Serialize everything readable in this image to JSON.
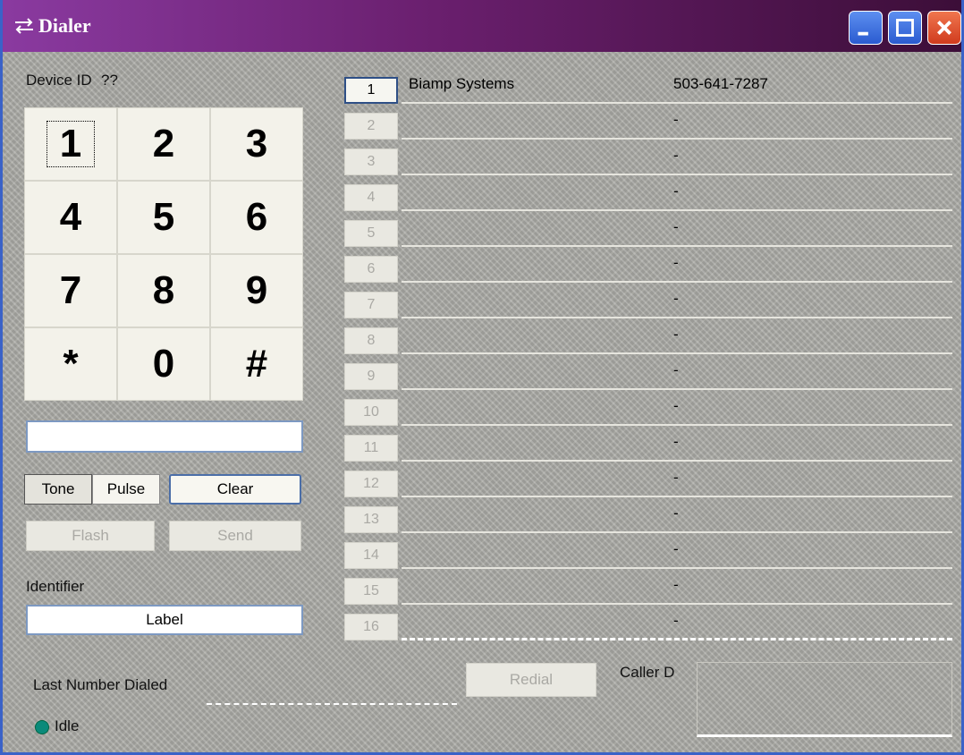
{
  "window": {
    "title": "Dialer",
    "minimize_label": "Minimize",
    "maximize_label": "Maximize",
    "close_label": "Close"
  },
  "device": {
    "label": "Device ID",
    "value": "??"
  },
  "keypad": {
    "keys": [
      "1",
      "2",
      "3",
      "4",
      "5",
      "6",
      "7",
      "8",
      "9",
      "*",
      "0",
      "#"
    ],
    "focused_key": "1"
  },
  "dial_display": {
    "value": ""
  },
  "controls": {
    "tone": "Tone",
    "pulse": "Pulse",
    "clear": "Clear",
    "flash": "Flash",
    "send": "Send"
  },
  "identifier": {
    "heading": "Identifier",
    "value": "Label"
  },
  "speed_dial": [
    {
      "index": "1",
      "name": "Biamp Systems",
      "number": "503-641-7287"
    },
    {
      "index": "2",
      "name": "",
      "number": ""
    },
    {
      "index": "3",
      "name": "",
      "number": ""
    },
    {
      "index": "4",
      "name": "",
      "number": ""
    },
    {
      "index": "5",
      "name": "",
      "number": ""
    },
    {
      "index": "6",
      "name": "",
      "number": ""
    },
    {
      "index": "7",
      "name": "",
      "number": ""
    },
    {
      "index": "8",
      "name": "",
      "number": ""
    },
    {
      "index": "9",
      "name": "",
      "number": ""
    },
    {
      "index": "10",
      "name": "",
      "number": ""
    },
    {
      "index": "11",
      "name": "",
      "number": ""
    },
    {
      "index": "12",
      "name": "",
      "number": ""
    },
    {
      "index": "13",
      "name": "",
      "number": ""
    },
    {
      "index": "14",
      "name": "",
      "number": ""
    },
    {
      "index": "15",
      "name": "",
      "number": ""
    },
    {
      "index": "16",
      "name": "",
      "number": ""
    }
  ],
  "speed_dial_separator": "-",
  "last_dialed": {
    "label": "Last Number Dialed",
    "value": ""
  },
  "redial": {
    "label": "Redial"
  },
  "caller_id": {
    "label": "Caller D",
    "value": ""
  },
  "status": {
    "text": "Idle",
    "led_color": "#0a8a7a"
  },
  "colors": {
    "titlebar": "#6a1f6e",
    "accent": "#3a62c8",
    "panel": "#a9a9a4"
  }
}
